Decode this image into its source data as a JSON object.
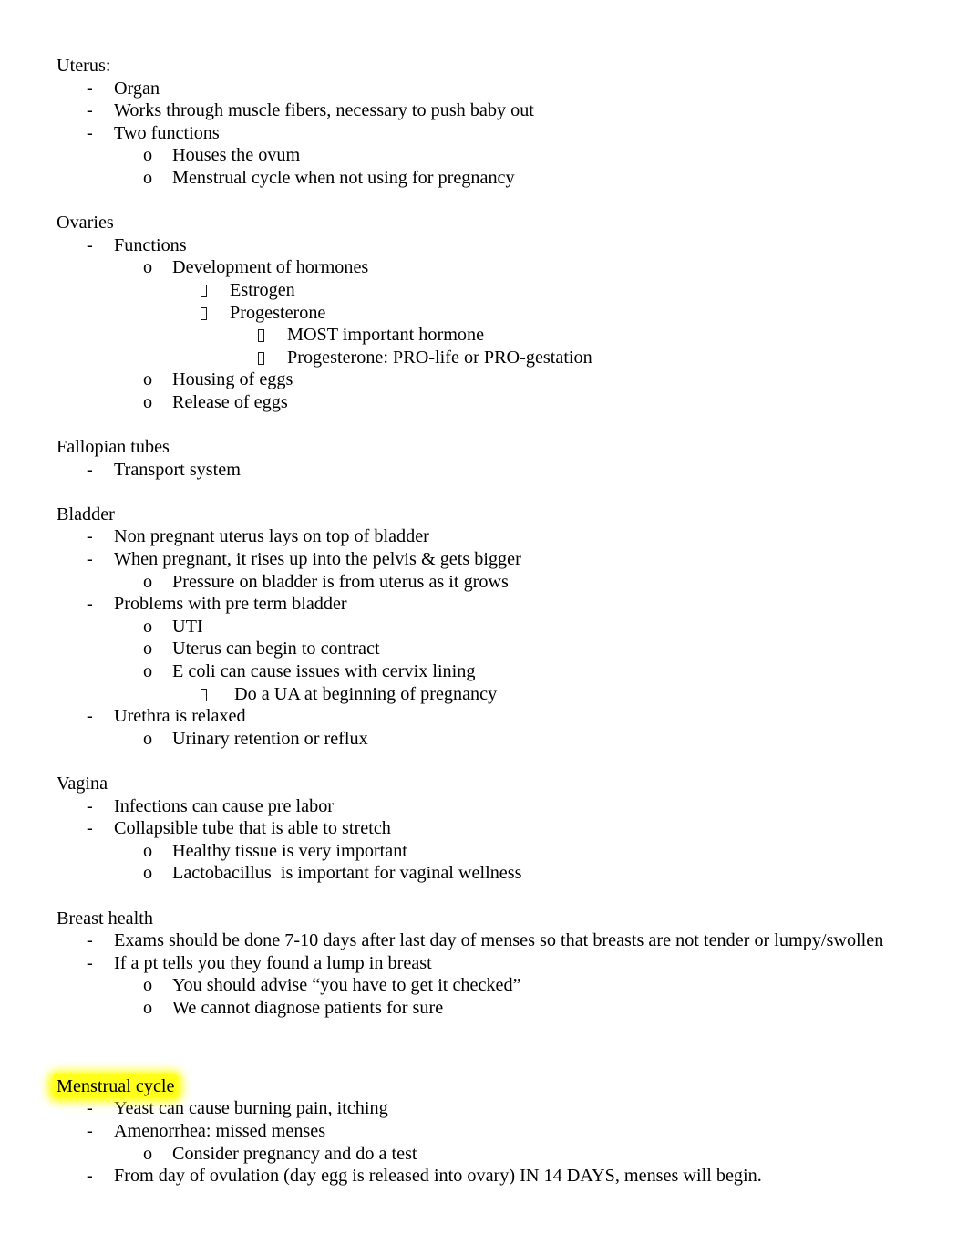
{
  "document": {
    "font_color": "#000000",
    "page_background": "#ffffff",
    "highlight_color": "#ffff00",
    "bullet_markers": {
      "level1": "-",
      "level2": "o",
      "level3": "missing-glyph-box",
      "level4": "missing-glyph-box"
    }
  },
  "sections": [
    {
      "heading": "Uterus:",
      "items": [
        {
          "level": 1,
          "text": "Organ"
        },
        {
          "level": 1,
          "text": "Works through muscle fibers, necessary to push baby out"
        },
        {
          "level": 1,
          "text": "Two functions"
        },
        {
          "level": 2,
          "text": "Houses the ovum"
        },
        {
          "level": 2,
          "text": "Menstrual cycle when not using for pregnancy"
        }
      ]
    },
    {
      "heading": "Ovaries",
      "items": [
        {
          "level": 1,
          "text": "Functions"
        },
        {
          "level": 2,
          "text": "Development of hormones"
        },
        {
          "level": 3,
          "text": "Estrogen"
        },
        {
          "level": 3,
          "text": "Progesterone"
        },
        {
          "level": 4,
          "text": "MOST important hormone"
        },
        {
          "level": 4,
          "text": "Progesterone: PRO-life or PRO-gestation"
        },
        {
          "level": 2,
          "text": "Housing of eggs"
        },
        {
          "level": 2,
          "text": "Release of eggs"
        }
      ]
    },
    {
      "heading": "Fallopian tubes",
      "items": [
        {
          "level": 1,
          "text": "Transport system"
        }
      ]
    },
    {
      "heading": "Bladder",
      "items": [
        {
          "level": 1,
          "text": "Non pregnant uterus lays on top of bladder"
        },
        {
          "level": 1,
          "text": "When pregnant, it rises up into the pelvis & gets bigger"
        },
        {
          "level": 2,
          "text": "Pressure on bladder is from uterus as it grows"
        },
        {
          "level": 1,
          "text": "Problems with pre term bladder"
        },
        {
          "level": 2,
          "text": "UTI"
        },
        {
          "level": 2,
          "text": "Uterus can begin to contract"
        },
        {
          "level": 2,
          "text": "E coli can cause issues with cervix lining"
        },
        {
          "level": 3,
          "text": " Do a UA at beginning of pregnancy"
        },
        {
          "level": 1,
          "text": "Urethra is relaxed"
        },
        {
          "level": 2,
          "text": "Urinary retention or reflux"
        }
      ]
    },
    {
      "heading": "Vagina",
      "items": [
        {
          "level": 1,
          "text": "Infections can cause pre labor"
        },
        {
          "level": 1,
          "text": "Collapsible tube that is able to stretch"
        },
        {
          "level": 2,
          "text": "Healthy tissue is very important"
        },
        {
          "level": 2,
          "text": "Lactobacillus  is important for vaginal wellness"
        }
      ]
    },
    {
      "heading": "Breast health",
      "items": [
        {
          "level": 1,
          "text": "Exams should be done 7-10 days after last day of menses so that breasts are not tender or lumpy/swollen"
        },
        {
          "level": 1,
          "text": "If a pt tells you they found a lump in breast"
        },
        {
          "level": 2,
          "text": "You should advise “you have to get it checked”"
        },
        {
          "level": 2,
          "text": "We cannot diagnose patients for sure"
        }
      ]
    },
    {
      "heading": "Menstrual cycle",
      "highlighted": true,
      "items": [
        {
          "level": 1,
          "text": "Yeast can cause burning pain, itching"
        },
        {
          "level": 1,
          "text": "Amenorrhea: missed menses"
        },
        {
          "level": 2,
          "text": "Consider pregnancy and do a test"
        },
        {
          "level": 1,
          "text": "From day of ovulation (day egg is released into ovary) IN 14 DAYS, menses will begin."
        }
      ]
    }
  ]
}
